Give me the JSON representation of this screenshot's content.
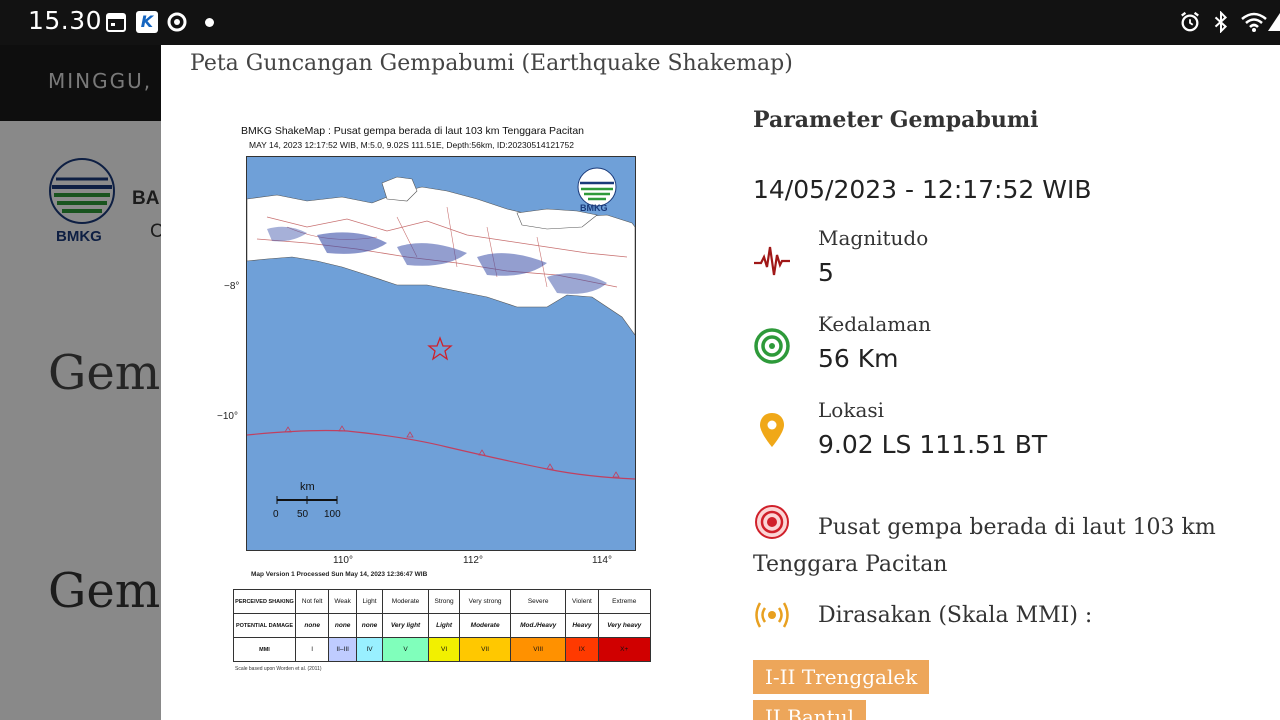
{
  "status_bar": {
    "time": "15.30",
    "icons": [
      "calendar-icon",
      "k-app-icon",
      "sync-icon",
      "notification-dot",
      "alarm-icon",
      "bluetooth-icon",
      "wifi-icon",
      "signal-icon"
    ]
  },
  "background_page": {
    "date_prefix": "MINGGU,",
    "logo_text": "BMKG",
    "org_line1": "BA",
    "org_line2": "C",
    "heading1": "Gemp",
    "heading2": "Gem"
  },
  "modal": {
    "title": "Peta Guncangan Gempabumi (Earthquake Shakemap)",
    "shakemap": {
      "header_line1": "BMKG ShakeMap : Pusat gempa berada di laut 103 km Tenggara Pacitan",
      "header_line2": "MAY 14, 2023 12:17:52 WIB, M:5.0, 9.02S 111.51E, Depth:56km, ID:20230514121752",
      "logo_text": "BMKG",
      "lat_labels": [
        "−8°",
        "−10°"
      ],
      "lon_labels": [
        "110°",
        "112°",
        "114°"
      ],
      "scale_unit": "km",
      "scale_ticks": [
        "0",
        "50",
        "100"
      ],
      "version_text": "Map Version 1 Processed Sun May 14, 2023 12:36:47 WIB",
      "mmi_table": {
        "row_labels": [
          "PERCEIVED SHAKING",
          "POTENTIAL DAMAGE",
          "MMI"
        ],
        "shaking": [
          "Not felt",
          "Weak",
          "Light",
          "Moderate",
          "Strong",
          "Very strong",
          "Severe",
          "Violent",
          "Extreme"
        ],
        "damage": [
          "none",
          "none",
          "none",
          "Very light",
          "Light",
          "Moderate",
          "Mod./Heavy",
          "Heavy",
          "Very heavy"
        ],
        "mmi": [
          "I",
          "II–III",
          "IV",
          "V",
          "VI",
          "VII",
          "VIII",
          "IX",
          "X+"
        ],
        "mmi_colors": [
          "#ffffff",
          "#bfccff",
          "#99f0ff",
          "#80ffbb",
          "#f2f000",
          "#ffc800",
          "#ff9100",
          "#ff3a00",
          "#d00000"
        ],
        "note": "Scale based upon Worden et al. (2011)"
      }
    },
    "parameters": {
      "title": "Parameter Gempabumi",
      "datetime": "14/05/2023 - 12:17:52 WIB",
      "magnitude_label": "Magnitudo",
      "magnitude_value": "5",
      "depth_label": "Kedalaman",
      "depth_value": "56 Km",
      "location_label": "Lokasi",
      "location_value": "9.02 LS 111.51 BT",
      "description": "Pusat gempa berada di laut 103 km Tenggara Pacitan",
      "felt_label": "Dirasakan (Skala MMI) :",
      "felt_regions": [
        "I-II Trenggalek",
        "II Bantul"
      ],
      "colors": {
        "magnitude_icon": "#a01818",
        "depth_icon": "#2e9a3a",
        "location_icon": "#f0a818",
        "epicenter_icon": "#d0202a",
        "felt_icon": "#e8a020",
        "badge": "#eda65a"
      }
    }
  }
}
